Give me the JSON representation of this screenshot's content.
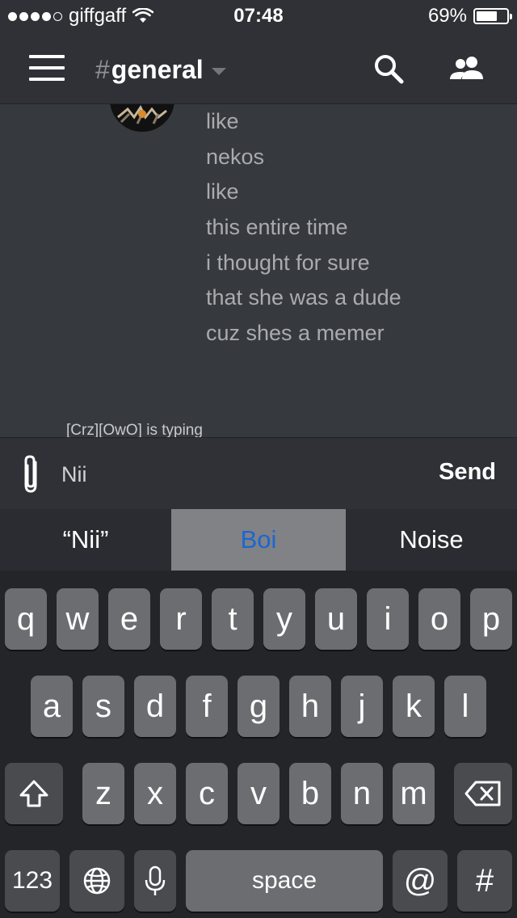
{
  "status_bar": {
    "carrier": "giffgaff",
    "time": "07:48",
    "battery_percent": "69%",
    "battery_level": 0.69,
    "signal_bars": 4,
    "signal_total": 5,
    "wifi_icon": "wifi-icon"
  },
  "nav": {
    "menu_icon": "hamburger-icon",
    "channel_hash": "#",
    "channel_name": "general",
    "dropdown_icon": "chevron-down-icon",
    "search_icon": "search-icon",
    "members_icon": "members-icon"
  },
  "messages": {
    "lines": [
      "like",
      "nekos",
      "like",
      "this entire time",
      "i thought for sure",
      "that she was a dude",
      "cuz shes a memer"
    ],
    "typing_indicator": "[Crz][OwO] is typing"
  },
  "composer": {
    "attach_icon": "paperclip-icon",
    "input_value": "Nii",
    "send_label": "Send"
  },
  "predictive": {
    "suggestions": [
      "“Nii”",
      "Boi",
      "Noise"
    ],
    "selected_index": 1
  },
  "keyboard": {
    "row1": [
      "q",
      "w",
      "e",
      "r",
      "t",
      "y",
      "u",
      "i",
      "o",
      "p"
    ],
    "row2": [
      "a",
      "s",
      "d",
      "f",
      "g",
      "h",
      "j",
      "k",
      "l"
    ],
    "row3": [
      "z",
      "x",
      "c",
      "v",
      "b",
      "n",
      "m"
    ],
    "shift_icon": "shift-icon",
    "backspace_icon": "backspace-icon",
    "numbers_label": "123",
    "globe_icon": "globe-icon",
    "mic_icon": "microphone-icon",
    "space_label": "space",
    "at_label": "@",
    "hash_label": "#"
  },
  "colors": {
    "background": "#36393e",
    "header": "#2f3136",
    "suggestion_highlight": "#1b66d4"
  }
}
